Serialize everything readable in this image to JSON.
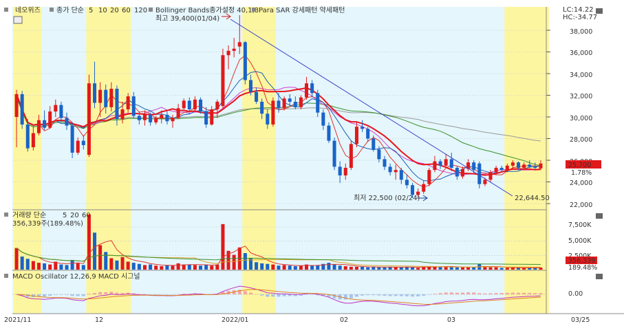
{
  "header": {
    "stock_name": "네오위즈",
    "ma_title": "종가 단순",
    "ma_periods": [
      "5",
      "10",
      "20",
      "60",
      "120"
    ],
    "ma_colors": [
      "#e0342c",
      "#1a5fb4",
      "#e0342c",
      "#3a8f2c",
      "#888888"
    ],
    "bollinger": "Bollinger Bands종가설정 40,1,8",
    "para_sar": "Para SAR 강세패턴  약세패턴",
    "high_label": "최고 39,400(01/04)",
    "lc": "LC:14.22",
    "hc": "HC:-34.77"
  },
  "price_panel": {
    "last_price": "25,700",
    "change_pct": "1.78%",
    "low_label": "최저 22,500 (02/24)",
    "trend_label": "22,644.50",
    "y_ticks": [
      "38,000",
      "36,000",
      "34,000",
      "32,000",
      "30,000",
      "28,000",
      "26,000",
      "24,000",
      "22,000"
    ]
  },
  "volume_panel": {
    "title": "거래량  단순",
    "ma_periods": [
      "5",
      "20",
      "60"
    ],
    "value_label": "356,339주(189.48%)",
    "y_ticks": [
      "7,500K",
      "5,000K",
      "2,500K"
    ],
    "last_volume": "356,339",
    "last_pct": "189.48%"
  },
  "macd_panel": {
    "title": "MACD Oscillator 12,26,9  MACD  시그널",
    "y_ticks": [
      "0.00"
    ]
  },
  "x_axis": {
    "labels": [
      "2021/11",
      "12",
      "2022/01",
      "02",
      "03",
      "03/25"
    ]
  },
  "colors": {
    "up": "#e0191b",
    "down": "#1a63c8",
    "bg_band": "#e5f6fc",
    "yellow_band": "#fdf6a0"
  },
  "chart_data": {
    "type": "candlestick",
    "price_range": [
      21500,
      39500
    ],
    "candles": [
      {
        "o": 30000,
        "h": 32500,
        "l": 27200,
        "c": 32100
      },
      {
        "o": 32100,
        "h": 32400,
        "l": 28900,
        "c": 29300
      },
      {
        "o": 29300,
        "h": 29800,
        "l": 26800,
        "c": 27100
      },
      {
        "o": 27200,
        "h": 29100,
        "l": 26900,
        "c": 28500
      },
      {
        "o": 28500,
        "h": 30200,
        "l": 28300,
        "c": 29700
      },
      {
        "o": 29700,
        "h": 30600,
        "l": 28800,
        "c": 29000
      },
      {
        "o": 29000,
        "h": 31000,
        "l": 28900,
        "c": 30500
      },
      {
        "o": 30500,
        "h": 31600,
        "l": 30000,
        "c": 31100
      },
      {
        "o": 31100,
        "h": 31400,
        "l": 29600,
        "c": 29900
      },
      {
        "o": 29900,
        "h": 30400,
        "l": 28800,
        "c": 29200
      },
      {
        "o": 29200,
        "h": 29500,
        "l": 26200,
        "c": 26700
      },
      {
        "o": 26700,
        "h": 28100,
        "l": 26500,
        "c": 27800
      },
      {
        "o": 27800,
        "h": 28300,
        "l": 27000,
        "c": 27400
      },
      {
        "o": 26500,
        "h": 33900,
        "l": 26300,
        "c": 33100
      },
      {
        "o": 33100,
        "h": 35100,
        "l": 30800,
        "c": 31300
      },
      {
        "o": 31300,
        "h": 33200,
        "l": 30000,
        "c": 32500
      },
      {
        "o": 32500,
        "h": 33000,
        "l": 30300,
        "c": 30900
      },
      {
        "o": 30900,
        "h": 33200,
        "l": 30500,
        "c": 32600
      },
      {
        "o": 32600,
        "h": 32900,
        "l": 29200,
        "c": 29800
      },
      {
        "o": 29800,
        "h": 31400,
        "l": 29400,
        "c": 30700
      },
      {
        "o": 30700,
        "h": 32200,
        "l": 30400,
        "c": 31900
      },
      {
        "o": 31900,
        "h": 32300,
        "l": 29900,
        "c": 30100
      },
      {
        "o": 30100,
        "h": 30500,
        "l": 29300,
        "c": 29700
      },
      {
        "o": 29700,
        "h": 30600,
        "l": 29200,
        "c": 30200
      },
      {
        "o": 30200,
        "h": 30400,
        "l": 29200,
        "c": 29500
      },
      {
        "o": 29500,
        "h": 30100,
        "l": 29300,
        "c": 29900
      },
      {
        "o": 29900,
        "h": 30600,
        "l": 29400,
        "c": 30200
      },
      {
        "o": 30200,
        "h": 30500,
        "l": 29300,
        "c": 29600
      },
      {
        "o": 29600,
        "h": 30200,
        "l": 29000,
        "c": 29900
      },
      {
        "o": 29900,
        "h": 31200,
        "l": 29800,
        "c": 30800
      },
      {
        "o": 30800,
        "h": 31700,
        "l": 30700,
        "c": 31500
      },
      {
        "o": 31500,
        "h": 31800,
        "l": 30400,
        "c": 30700
      },
      {
        "o": 30700,
        "h": 31900,
        "l": 30500,
        "c": 31600
      },
      {
        "o": 31600,
        "h": 31800,
        "l": 30300,
        "c": 30500
      },
      {
        "o": 30500,
        "h": 30900,
        "l": 29000,
        "c": 29300
      },
      {
        "o": 29300,
        "h": 31000,
        "l": 29200,
        "c": 30700
      },
      {
        "o": 30700,
        "h": 31600,
        "l": 29900,
        "c": 31400
      },
      {
        "o": 31000,
        "h": 36300,
        "l": 30800,
        "c": 35700
      },
      {
        "o": 35700,
        "h": 36600,
        "l": 34400,
        "c": 36100
      },
      {
        "o": 36100,
        "h": 37300,
        "l": 35500,
        "c": 36300
      },
      {
        "o": 36500,
        "h": 39400,
        "l": 35800,
        "c": 36900
      },
      {
        "o": 36900,
        "h": 37000,
        "l": 33000,
        "c": 33400
      },
      {
        "o": 33400,
        "h": 33900,
        "l": 32000,
        "c": 32300
      },
      {
        "o": 32300,
        "h": 32700,
        "l": 31200,
        "c": 31400
      },
      {
        "o": 31400,
        "h": 31700,
        "l": 29800,
        "c": 30300
      },
      {
        "o": 30300,
        "h": 30700,
        "l": 28900,
        "c": 29300
      },
      {
        "o": 29300,
        "h": 31800,
        "l": 29100,
        "c": 31500
      },
      {
        "o": 31500,
        "h": 32200,
        "l": 30400,
        "c": 30800
      },
      {
        "o": 30800,
        "h": 31900,
        "l": 30600,
        "c": 31700
      },
      {
        "o": 31700,
        "h": 32100,
        "l": 31000,
        "c": 31400
      },
      {
        "o": 31400,
        "h": 31900,
        "l": 30700,
        "c": 30900
      },
      {
        "o": 30900,
        "h": 32000,
        "l": 30700,
        "c": 31800
      },
      {
        "o": 31800,
        "h": 33700,
        "l": 31600,
        "c": 33100
      },
      {
        "o": 33100,
        "h": 33400,
        "l": 31800,
        "c": 32200
      },
      {
        "o": 32200,
        "h": 32500,
        "l": 30000,
        "c": 30400
      },
      {
        "o": 30400,
        "h": 30700,
        "l": 28800,
        "c": 29200
      },
      {
        "o": 29200,
        "h": 29500,
        "l": 27600,
        "c": 27800
      },
      {
        "o": 27800,
        "h": 28100,
        "l": 25100,
        "c": 25400
      },
      {
        "o": 25400,
        "h": 25900,
        "l": 23900,
        "c": 24600
      },
      {
        "o": 24600,
        "h": 25700,
        "l": 24200,
        "c": 25300
      },
      {
        "o": 25300,
        "h": 27800,
        "l": 25100,
        "c": 27500
      },
      {
        "o": 27500,
        "h": 29600,
        "l": 27200,
        "c": 29100
      },
      {
        "o": 29100,
        "h": 29700,
        "l": 28600,
        "c": 28900
      },
      {
        "o": 28900,
        "h": 29100,
        "l": 27700,
        "c": 28000
      },
      {
        "o": 28000,
        "h": 28300,
        "l": 26800,
        "c": 27000
      },
      {
        "o": 27000,
        "h": 27300,
        "l": 25800,
        "c": 26100
      },
      {
        "o": 26100,
        "h": 26400,
        "l": 25100,
        "c": 25400
      },
      {
        "o": 25400,
        "h": 25700,
        "l": 24600,
        "c": 24900
      },
      {
        "o": 24900,
        "h": 25600,
        "l": 24200,
        "c": 25100
      },
      {
        "o": 25100,
        "h": 25300,
        "l": 23800,
        "c": 24200
      },
      {
        "o": 24200,
        "h": 24700,
        "l": 23400,
        "c": 23700
      },
      {
        "o": 23700,
        "h": 23900,
        "l": 22500,
        "c": 22800
      },
      {
        "o": 22800,
        "h": 23400,
        "l": 22600,
        "c": 23100
      },
      {
        "o": 23100,
        "h": 24100,
        "l": 22900,
        "c": 23800
      },
      {
        "o": 23800,
        "h": 25300,
        "l": 23600,
        "c": 25100
      },
      {
        "o": 25100,
        "h": 26400,
        "l": 24900,
        "c": 25900
      },
      {
        "o": 25900,
        "h": 26100,
        "l": 25200,
        "c": 25500
      },
      {
        "o": 25500,
        "h": 26600,
        "l": 25300,
        "c": 26100
      },
      {
        "o": 26100,
        "h": 26700,
        "l": 25000,
        "c": 25300
      },
      {
        "o": 25300,
        "h": 25500,
        "l": 24200,
        "c": 24500
      },
      {
        "o": 24500,
        "h": 25400,
        "l": 24300,
        "c": 25200
      },
      {
        "o": 25200,
        "h": 26100,
        "l": 25000,
        "c": 25800
      },
      {
        "o": 25800,
        "h": 26000,
        "l": 24800,
        "c": 25100
      },
      {
        "o": 25700,
        "h": 25900,
        "l": 23400,
        "c": 23800
      },
      {
        "o": 23800,
        "h": 24400,
        "l": 23600,
        "c": 24200
      },
      {
        "o": 24200,
        "h": 25100,
        "l": 24000,
        "c": 24900
      },
      {
        "o": 24900,
        "h": 25500,
        "l": 24700,
        "c": 25300
      },
      {
        "o": 25300,
        "h": 25500,
        "l": 24900,
        "c": 25100
      },
      {
        "o": 25100,
        "h": 25700,
        "l": 24900,
        "c": 25500
      },
      {
        "o": 25500,
        "h": 26000,
        "l": 25200,
        "c": 25800
      },
      {
        "o": 25800,
        "h": 25900,
        "l": 25100,
        "c": 25300
      },
      {
        "o": 25300,
        "h": 25800,
        "l": 25100,
        "c": 25600
      },
      {
        "o": 25600,
        "h": 26000,
        "l": 25300,
        "c": 25400
      },
      {
        "o": 25400,
        "h": 25800,
        "l": 25100,
        "c": 25300
      },
      {
        "o": 25250,
        "h": 26000,
        "l": 25100,
        "c": 25700
      }
    ],
    "volume_k": [
      3800,
      2300,
      1900,
      1500,
      1200,
      1100,
      900,
      1400,
      900,
      800,
      1700,
      1100,
      800,
      9700,
      6500,
      4300,
      3100,
      2000,
      1600,
      2200,
      1400,
      1200,
      1000,
      800,
      900,
      700,
      600,
      800,
      700,
      1100,
      900,
      900,
      800,
      700,
      900,
      700,
      900,
      8000,
      3300,
      2600,
      3900,
      2900,
      2000,
      1300,
      1100,
      1000,
      900,
      700,
      800,
      700,
      600,
      700,
      900,
      700,
      800,
      1000,
      1200,
      900,
      700,
      600,
      500,
      500,
      500,
      400,
      500,
      400,
      400,
      500,
      400,
      400,
      500,
      400,
      300,
      500,
      600,
      600,
      500,
      500,
      500,
      400,
      400,
      400,
      400,
      1000,
      500,
      400,
      400,
      300,
      300,
      400,
      300,
      300,
      300,
      300,
      356
    ]
  }
}
